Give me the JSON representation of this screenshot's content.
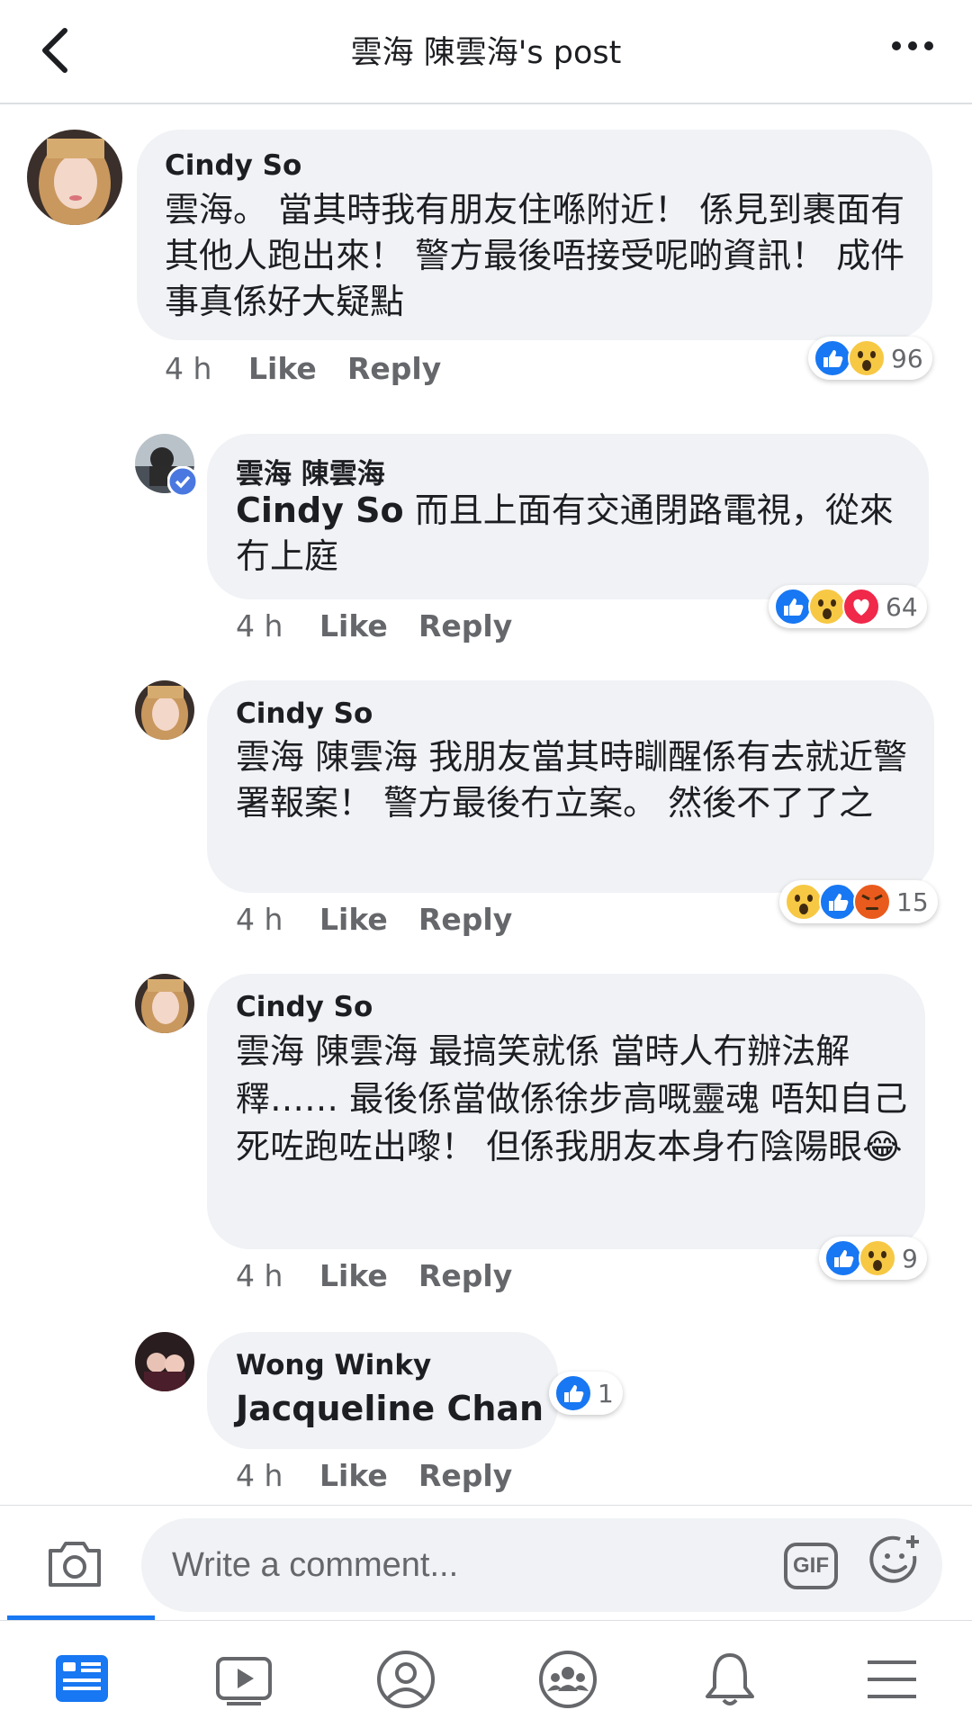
{
  "header": {
    "title": "雲海 陳雲海's post",
    "back_icon": "chevron-left-icon",
    "more_icon": "more-dots-icon"
  },
  "comments": [
    {
      "author": "Cindy So",
      "text": "雲海。 當其時我有朋友住喺附近！ 係見到裹面有其他人跑出來！ 警方最後唔接受呢啲資訊！ 成件事真係好大疑點",
      "time": "4 h",
      "like": "Like",
      "reply": "Reply",
      "reactions": [
        "like",
        "wow"
      ],
      "reaction_count": "96"
    },
    {
      "author": "雲海 陳雲海",
      "mention": "Cindy So",
      "text": " 而且上面有交通閉路電視，從來冇上庭",
      "time": "4 h",
      "like": "Like",
      "reply": "Reply",
      "reactions": [
        "like",
        "wow",
        "love"
      ],
      "reaction_count": "64",
      "verified": true
    },
    {
      "author": "Cindy So",
      "text": "雲海 陳雲海 我朋友當其時瞓醒係有去就近警署報案！ 警方最後冇立案。 然後不了了之",
      "time": "4 h",
      "like": "Like",
      "reply": "Reply",
      "reactions": [
        "wow",
        "like",
        "angry"
      ],
      "reaction_count": "15"
    },
    {
      "author": "Cindy So",
      "text": "雲海 陳雲海 最搞笑就係 當時人冇辦法解釋…… 最後係當做係徐步高嘅靈魂 唔知自己死咗跑咗出嚟！ 但係我朋友本身冇陰陽眼",
      "emoji": "😂",
      "time": "4 h",
      "like": "Like",
      "reply": "Reply",
      "reactions": [
        "like",
        "wow"
      ],
      "reaction_count": "9"
    },
    {
      "author": "Wong Winky",
      "mention": "Jacqueline Chan",
      "text": "",
      "time": "4 h",
      "like": "Like",
      "reply": "Reply",
      "reactions": [
        "like"
      ],
      "reaction_count": "1"
    }
  ],
  "composer": {
    "placeholder": "Write a comment...",
    "camera_icon": "camera-icon",
    "gif_label": "GIF",
    "emoji_icon": "emoji-add-icon"
  },
  "tabbar": {
    "tabs": [
      "news-feed-icon",
      "watch-icon",
      "profile-icon",
      "groups-icon",
      "notifications-icon",
      "menu-icon"
    ],
    "active_color": "#1877f2",
    "inactive_color": "#65676b"
  }
}
